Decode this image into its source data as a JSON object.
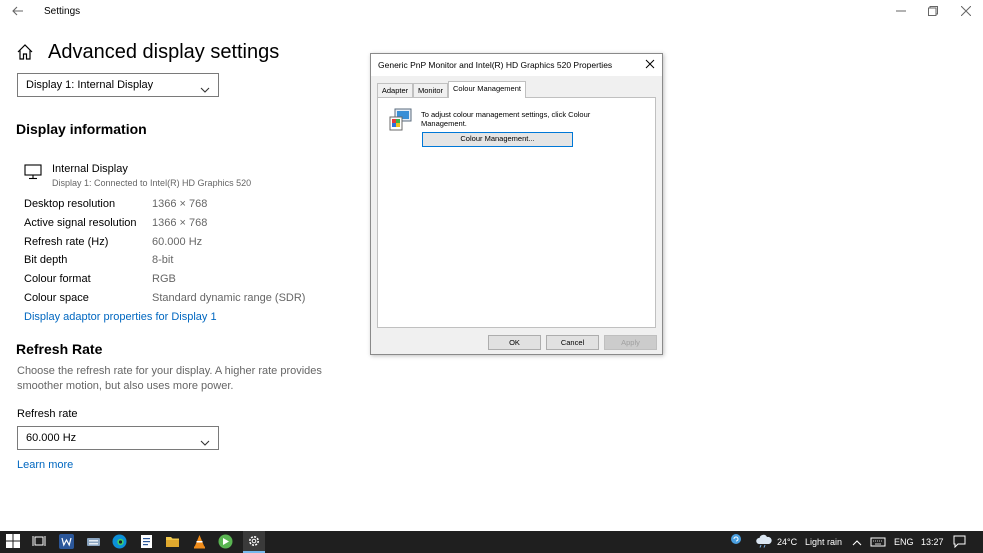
{
  "window": {
    "app_title": "Settings",
    "back_icon": "back-arrow-icon",
    "controls": {
      "minimize": "minimize-icon",
      "maximize": "maximize-icon",
      "close": "close-icon"
    }
  },
  "page": {
    "title": "Advanced display settings",
    "home_icon": "home-icon"
  },
  "display_select": {
    "value": "Display 1: Internal Display"
  },
  "display_info": {
    "heading": "Display information",
    "monitor_name": "Internal Display",
    "monitor_sub": "Display 1: Connected to Intel(R) HD Graphics 520",
    "rows": [
      {
        "label": "Desktop resolution",
        "value": "1366 × 768"
      },
      {
        "label": "Active signal resolution",
        "value": "1366 × 768"
      },
      {
        "label": "Refresh rate (Hz)",
        "value": "60.000 Hz"
      },
      {
        "label": "Bit depth",
        "value": "8-bit"
      },
      {
        "label": "Colour format",
        "value": "RGB"
      },
      {
        "label": "Colour space",
        "value": "Standard dynamic range (SDR)"
      }
    ],
    "adapter_link": "Display adaptor properties for Display 1"
  },
  "refresh_rate": {
    "heading": "Refresh Rate",
    "description": "Choose the refresh rate for your display. A higher rate provides smoother motion, but also uses more power.",
    "field_label": "Refresh rate",
    "value": "60.000 Hz",
    "learn_more": "Learn more"
  },
  "dialog": {
    "title": "Generic PnP Monitor and Intel(R) HD Graphics 520 Properties",
    "tabs": [
      {
        "label": "Adapter",
        "active": false
      },
      {
        "label": "Monitor",
        "active": false
      },
      {
        "label": "Colour Management",
        "active": true
      }
    ],
    "panel_text": "To adjust colour management settings, click Colour Management.",
    "panel_button": "Colour Management...",
    "buttons": {
      "ok": "OK",
      "cancel": "Cancel",
      "apply": "Apply"
    }
  },
  "taskbar": {
    "icons": [
      "windows-start-icon",
      "task-view-icon",
      "word-icon",
      "keyboard-icon",
      "edge-icon",
      "notepad-icon",
      "file-explorer-icon",
      "vlc-icon",
      "green-app-icon",
      "settings-gear-icon"
    ],
    "weather": {
      "temperature": "24°C",
      "condition": "Light rain"
    },
    "language": "ENG",
    "time": "13:27"
  }
}
